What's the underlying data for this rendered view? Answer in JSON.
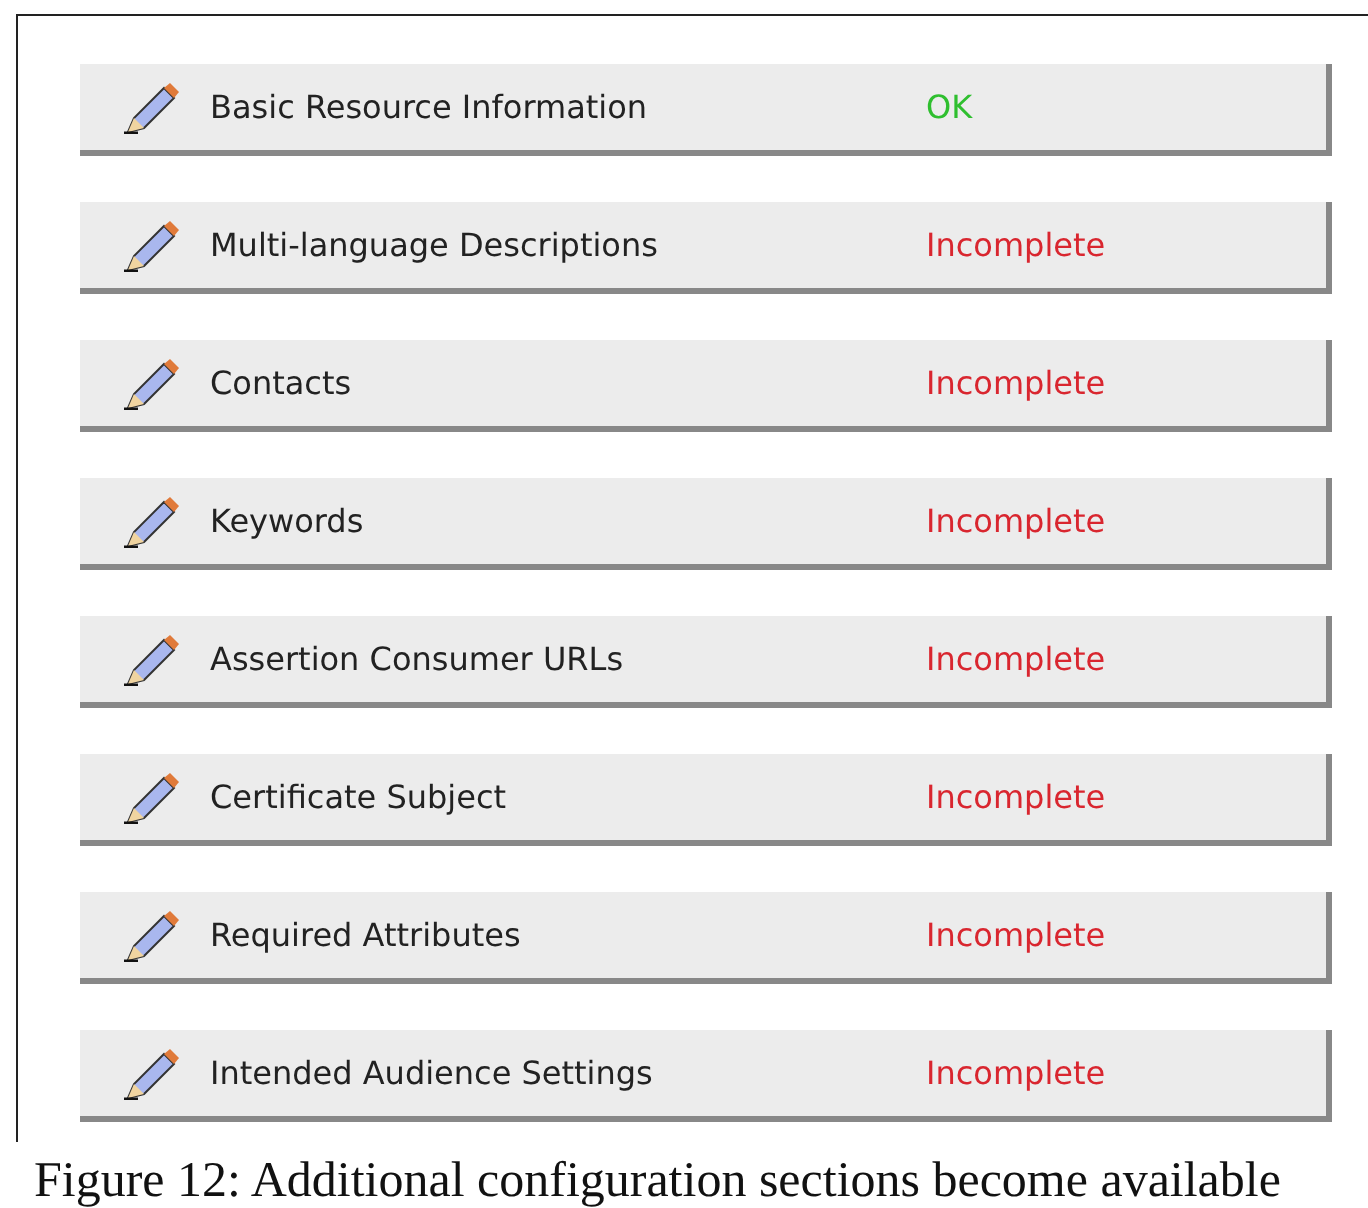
{
  "sections": [
    {
      "label": "Basic Resource Information",
      "status": "OK",
      "kind": "ok"
    },
    {
      "label": "Multi-language Descriptions",
      "status": "Incomplete",
      "kind": "incomplete"
    },
    {
      "label": "Contacts",
      "status": "Incomplete",
      "kind": "incomplete"
    },
    {
      "label": "Keywords",
      "status": "Incomplete",
      "kind": "incomplete"
    },
    {
      "label": "Assertion Consumer URLs",
      "status": "Incomplete",
      "kind": "incomplete"
    },
    {
      "label": "Certificate Subject",
      "status": "Incomplete",
      "kind": "incomplete"
    },
    {
      "label": "Required Attributes",
      "status": "Incomplete",
      "kind": "incomplete"
    },
    {
      "label": "Intended Audience Settings",
      "status": "Incomplete",
      "kind": "incomplete"
    }
  ],
  "caption": "Figure 12: Additional configuration sections become available"
}
